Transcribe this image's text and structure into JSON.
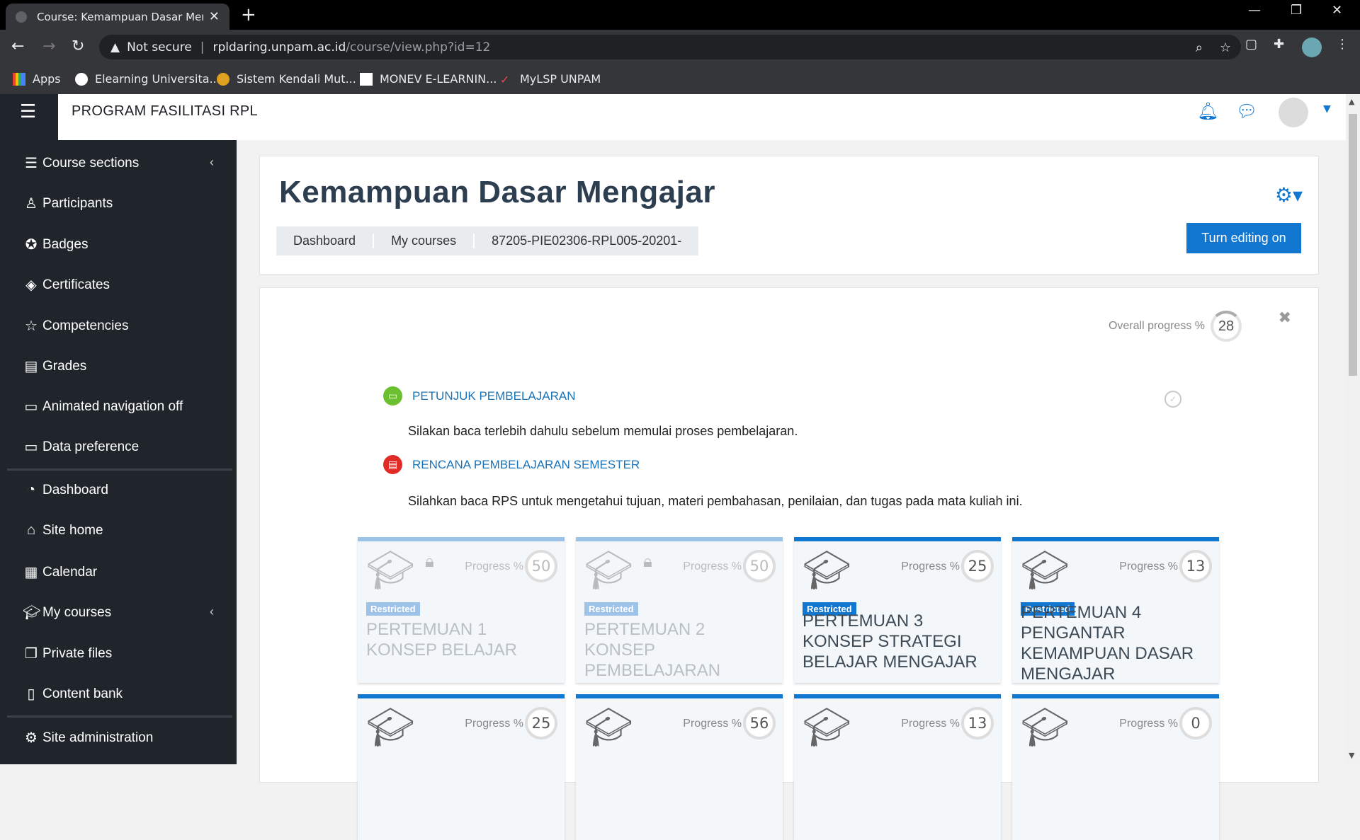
{
  "browser": {
    "tab_title": "Course: Kemampuan Dasar Meng",
    "omnibox_warning": "Not secure",
    "url_domain": "rpldaring.unpam.ac.id",
    "url_path": "/course/view.php?id=12",
    "bookmarks": [
      "Apps",
      "Elearning Universita...",
      "Sistem Kendali Mut...",
      "MONEV E-LEARNIN...",
      "MyLSP UNPAM"
    ]
  },
  "navbar": {
    "brand": "PROGRAM FASILITASI RPL"
  },
  "drawer": {
    "items": [
      {
        "label": "Course sections",
        "icon": "list-icon"
      },
      {
        "label": "Participants",
        "icon": "users-icon"
      },
      {
        "label": "Badges",
        "icon": "badge-icon"
      },
      {
        "label": "Certificates",
        "icon": "layers-icon"
      },
      {
        "label": "Competencies",
        "icon": "star-icon"
      },
      {
        "label": "Grades",
        "icon": "book-icon"
      },
      {
        "label": "Animated navigation off",
        "icon": "folder-icon"
      },
      {
        "label": "Data preference",
        "icon": "folder-icon"
      },
      {
        "label": "Dashboard",
        "icon": "dashboard-icon"
      },
      {
        "label": "Site home",
        "icon": "home-icon"
      },
      {
        "label": "Calendar",
        "icon": "calendar-icon"
      },
      {
        "label": "My courses",
        "icon": "mortarboard-icon"
      },
      {
        "label": "Private files",
        "icon": "files-icon"
      },
      {
        "label": "Content bank",
        "icon": "clipboard-icon"
      },
      {
        "label": "Site administration",
        "icon": "gear-icon"
      }
    ]
  },
  "header": {
    "title": "Kemampuan Dasar Mengajar",
    "breadcrumb": [
      "Dashboard",
      "My courses",
      "87205-PIE02306-RPL005-20201-"
    ],
    "edit_button": "Turn editing on"
  },
  "course": {
    "overall_label": "Overall progress %",
    "overall_value": "28",
    "activities": [
      {
        "title": "PETUNJUK PEMBELAJARAN",
        "desc": "Silakan baca terlebih dahulu sebelum memulai proses pembelajaran.",
        "icon": "presentation-icon",
        "color": "#6cbf2f"
      },
      {
        "title": "RENCANA PEMBELAJARAN SEMESTER",
        "desc": "Silahkan baca RPS untuk mengetahui tujuan, materi pembahasan, penilaian, dan tugas pada mata kuliah ini.",
        "icon": "pdf-icon",
        "color": "#e02b27"
      }
    ],
    "progress_label": "Progress %",
    "restricted_label": "Restricted",
    "tiles": [
      {
        "title": "PERTEMUAN 1 KONSEP BELAJAR",
        "progress": "50"
      },
      {
        "title": "PERTEMUAN 2 KONSEP PEMBELAJARAN",
        "progress": "50"
      },
      {
        "title": "PERTEMUAN 3 KONSEP STRATEGI BELAJAR MENGAJAR",
        "progress": "25"
      },
      {
        "title": "PERTEMUAN 4 PENGANTAR KEMAMPUAN DASAR MENGAJAR",
        "progress": "13"
      },
      {
        "progress": "25"
      },
      {
        "progress": "56"
      },
      {
        "progress": "13"
      },
      {
        "progress": "0"
      }
    ]
  },
  "colors": {
    "accent": "#1177d1",
    "drawer_bg": "#1f252b"
  }
}
